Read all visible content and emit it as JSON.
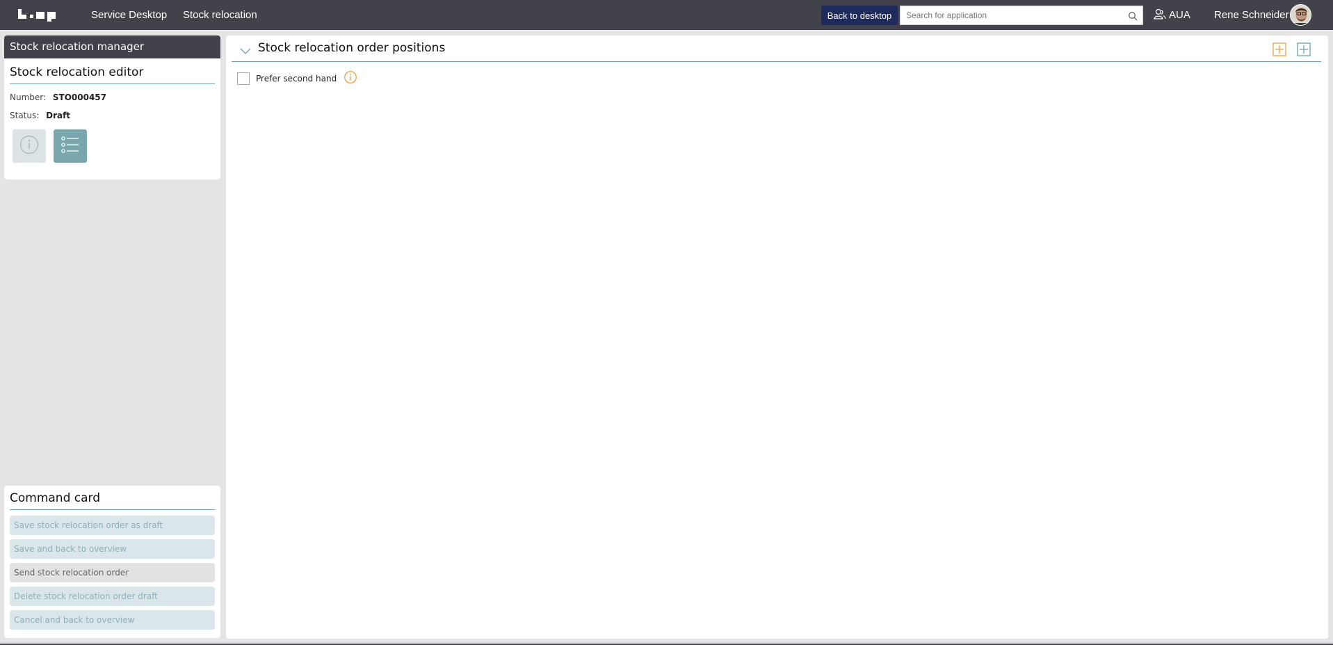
{
  "topbar": {
    "nav": [
      "Service Desktop",
      "Stock relocation"
    ],
    "back_label": "Back to desktop",
    "search_placeholder": "Search for application",
    "org": "AUA",
    "user": "Rene Schneider"
  },
  "sidebar": {
    "header": "Stock relocation manager",
    "editor_title": "Stock relocation editor",
    "number_label": "Number:",
    "number_value": "STO000457",
    "status_label": "Status:",
    "status_value": "Draft"
  },
  "command_card": {
    "title": "Command card",
    "buttons": [
      "Save stock relocation order as draft",
      "Save and back to overview",
      "Send stock relocation order",
      "Delete stock relocation order draft",
      "Cancel and back to overview"
    ]
  },
  "main": {
    "title": "Stock relocation order positions",
    "checkbox_label": "Prefer second hand"
  },
  "colors": {
    "topbar": "#42424b",
    "accent_teal": "#6aa3a8",
    "accent_orange": "#f0a040",
    "back_button": "#1e2b5c"
  }
}
